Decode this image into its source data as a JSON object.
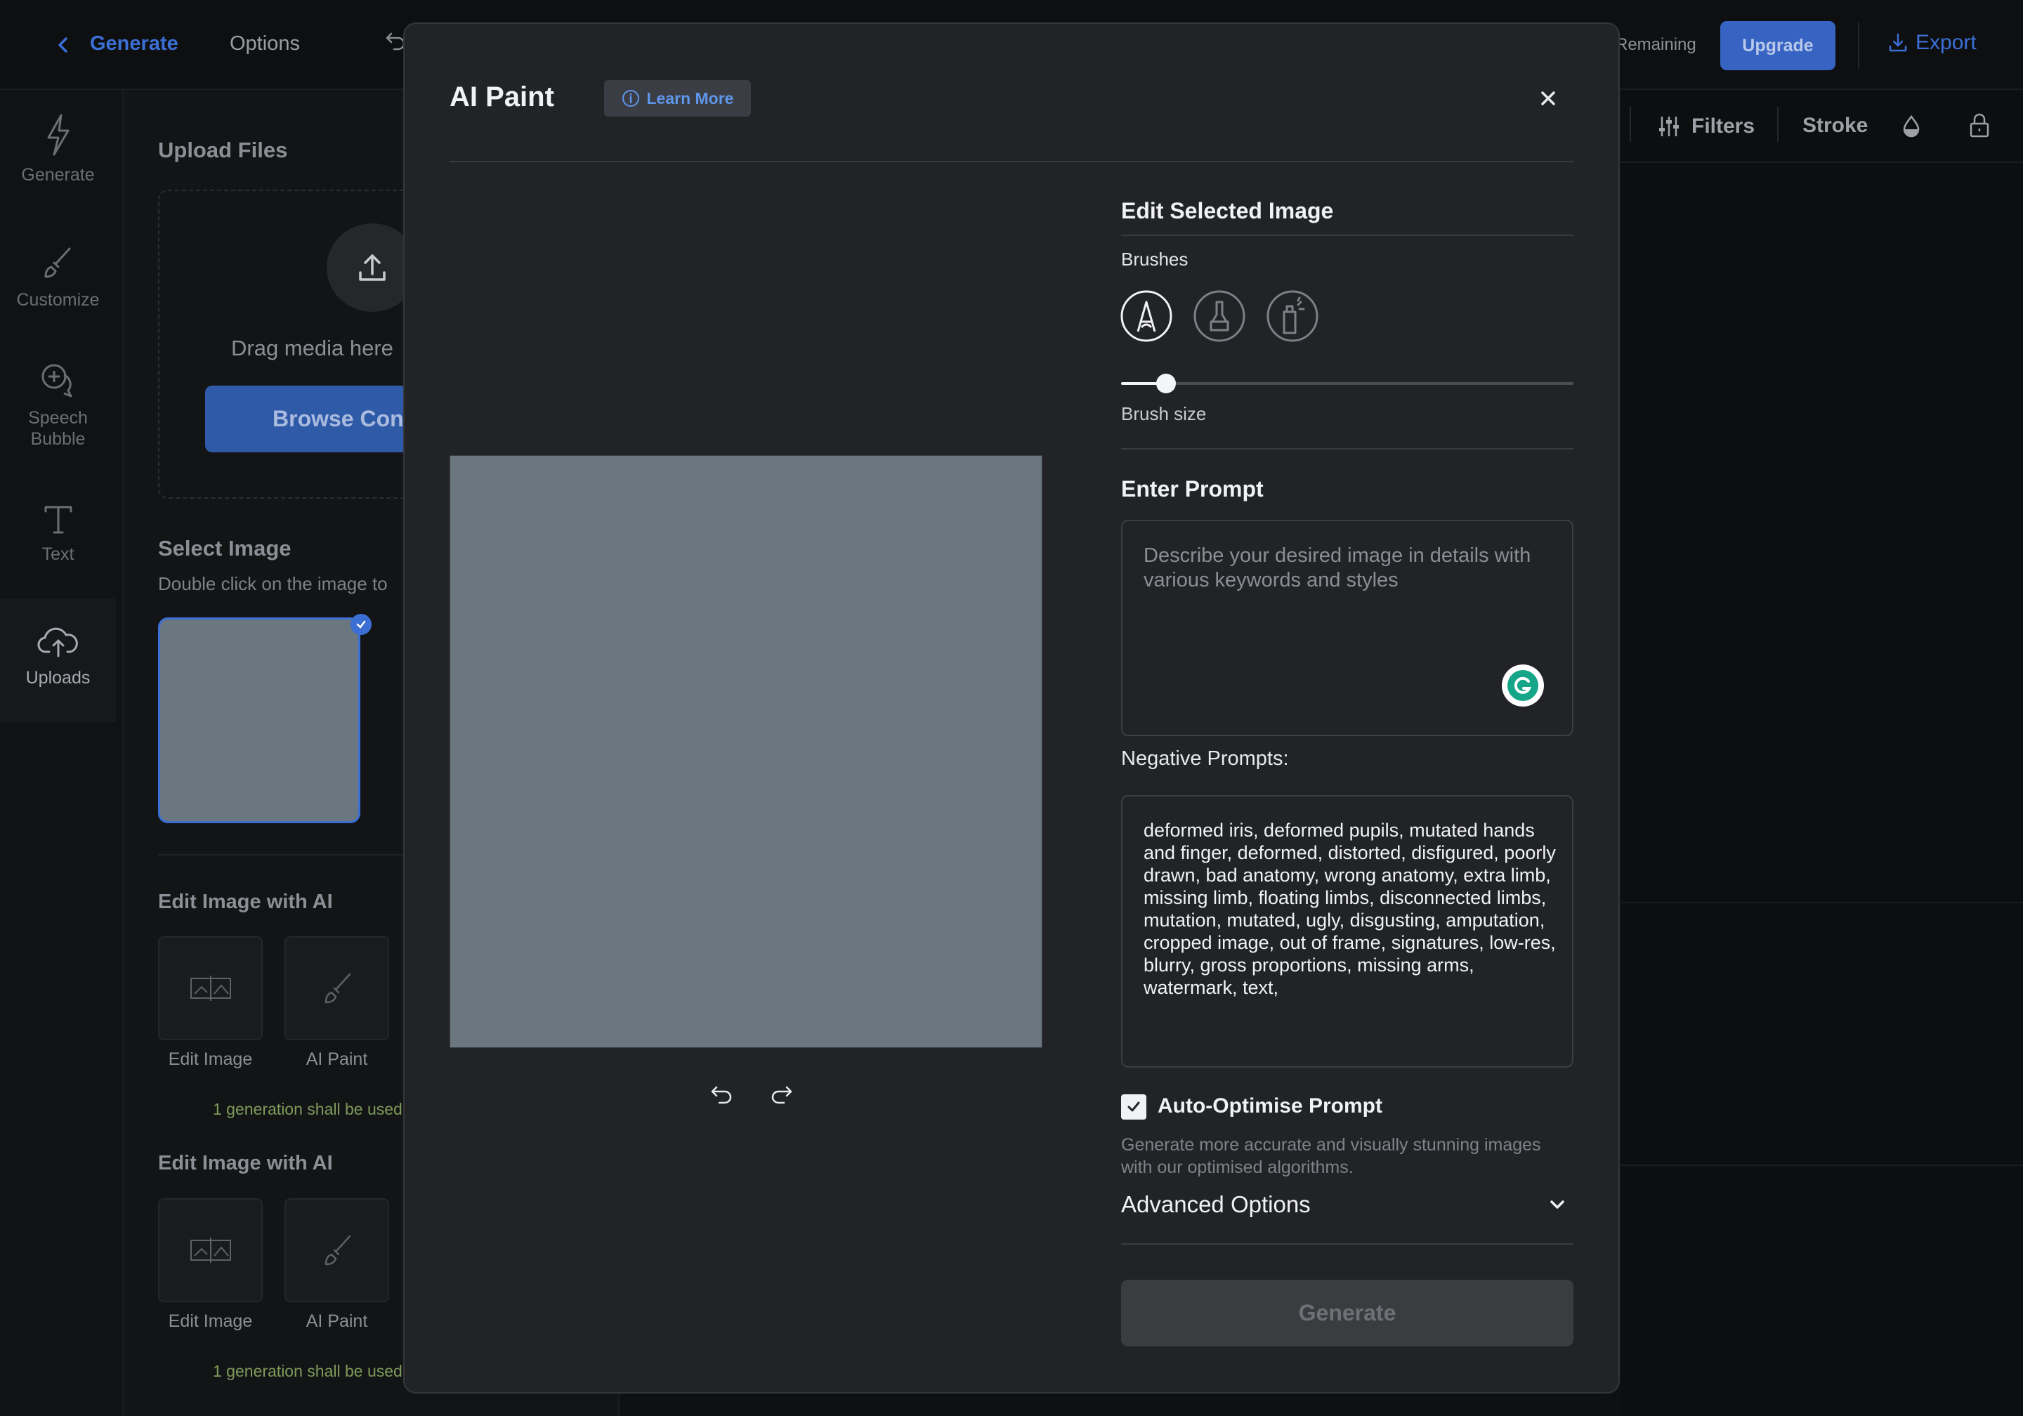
{
  "topbar": {
    "back_label": "Generate",
    "options_label": "Options",
    "remaining_label": "Remaining",
    "upgrade_label": "Upgrade",
    "export_label": "Export"
  },
  "rail": {
    "items": [
      {
        "label": "Generate",
        "icon": "lightning-icon"
      },
      {
        "label": "Customize",
        "icon": "brush-icon"
      },
      {
        "label": "Speech Bubble",
        "icon": "speech-bubble-icon"
      },
      {
        "label": "Text",
        "icon": "text-icon"
      },
      {
        "label": "Uploads",
        "icon": "cloud-upload-icon"
      }
    ]
  },
  "panel": {
    "upload_title": "Upload Files",
    "drag_text": "Drag media here",
    "browse_label": "Browse Con",
    "select_title": "Select Image",
    "select_sub": "Double click on the image to",
    "sections": [
      {
        "title": "Edit Image with AI",
        "tools": [
          "Edit Image",
          "AI Paint"
        ],
        "note": "1 generation shall be used"
      },
      {
        "title": "Edit Image with AI",
        "tools": [
          "Edit Image",
          "AI Paint"
        ],
        "note": "1 generation shall be used"
      }
    ]
  },
  "toolbar": {
    "filters_label": "Filters",
    "stroke_label": "Stroke"
  },
  "modal": {
    "title": "AI Paint",
    "learn_more": "Learn More",
    "edit_title": "Edit Selected Image",
    "brushes_label": "Brushes",
    "brushes": [
      "pencil-brush-icon",
      "marker-brush-icon",
      "spray-brush-icon"
    ],
    "brush_size_label": "Brush size",
    "brush_size_value": 0.1,
    "prompt_title": "Enter Prompt",
    "prompt_placeholder": "Describe your desired image in details with various keywords and styles",
    "prompt_value": "",
    "negative_title": "Negative Prompts:",
    "negative_text": "deformed iris, deformed pupils, mutated hands and finger, deformed, distorted, disfigured, poorly drawn, bad anatomy, wrong anatomy, extra limb, missing limb, floating limbs, disconnected limbs, mutation, mutated, ugly, disgusting, amputation, cropped image, out of frame, signatures, low-res, blurry, gross proportions, missing arms, watermark, text,",
    "auto_optimise_label": "Auto-Optimise Prompt",
    "auto_optimise_checked": true,
    "auto_optimise_desc": "Generate more accurate and visually stunning images with our optimised algorithms.",
    "advanced_label": "Advanced Options",
    "generate_label": "Generate"
  },
  "colors": {
    "accent": "#3b6fd4",
    "modal_bg": "#222326",
    "page_bg": "#0f1012"
  }
}
